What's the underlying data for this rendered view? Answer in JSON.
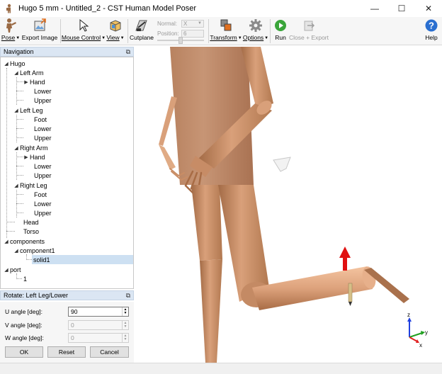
{
  "window": {
    "title": "Hugo 5 mm - Untitled_2 - CST Human Model Poser",
    "minimize": "—",
    "maximize": "☐",
    "close": "✕"
  },
  "toolbar": {
    "pose": "Pose",
    "export_image": "Export Image",
    "mouse_control": "Mouse Control",
    "view": "View",
    "cutplane": "Cutplane",
    "normal_label": "Normal:",
    "normal_value": "X",
    "position_label": "Position:",
    "position_value": "6",
    "transform": "Transform",
    "options": "Options",
    "run": "Run",
    "close_export": "Close + Export",
    "help": "Help"
  },
  "navigation": {
    "title": "Navigation",
    "tree": {
      "hugo": "Hugo",
      "left_arm": "Left Arm",
      "left_arm_hand": "Hand",
      "left_arm_lower": "Lower",
      "left_arm_upper": "Upper",
      "left_leg": "Left Leg",
      "left_leg_foot": "Foot",
      "left_leg_lower": "Lower",
      "left_leg_upper": "Upper",
      "right_arm": "Right Arm",
      "right_arm_hand": "Hand",
      "right_arm_lower": "Lower",
      "right_arm_upper": "Upper",
      "right_leg": "Right Leg",
      "right_leg_foot": "Foot",
      "right_leg_lower": "Lower",
      "right_leg_upper": "Upper",
      "head": "Head",
      "torso": "Torso",
      "components": "components",
      "component1": "component1",
      "solid1": "solid1",
      "port": "port",
      "port_1": "1"
    }
  },
  "rotate": {
    "title": "Rotate: Left Leg/Lower",
    "u_label": "U angle [deg]:",
    "u_value": "90",
    "v_label": "V angle [deg]:",
    "v_value": "0",
    "w_label": "W angle [deg]:",
    "w_value": "0",
    "ok": "OK",
    "reset": "Reset",
    "cancel": "Cancel"
  },
  "axes": {
    "x": "x",
    "y": "y",
    "z": "z"
  },
  "colors": {
    "skin": "#d9a07a",
    "skin_shade": "#a9714c",
    "nav_header": "#dbe6f3",
    "selection": "#cde0f2",
    "arrow_red": "#e01010",
    "axis_x": "#e02020",
    "axis_y": "#20a020",
    "axis_z": "#2040e0"
  }
}
